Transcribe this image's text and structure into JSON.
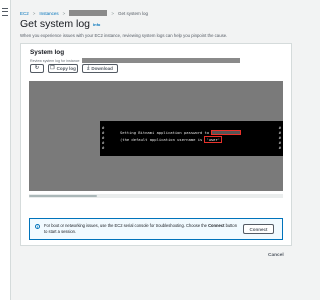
{
  "breadcrumb": {
    "items": [
      "EC2",
      "Instances",
      "",
      "Get system log"
    ],
    "separator": ">"
  },
  "page": {
    "title": "Get system log",
    "info_label": "Info",
    "description": "When you experience issues with your EC2 instance, reviewing system logs can help you pinpoint the cause."
  },
  "panel": {
    "title": "System log",
    "subtitle_prefix": "Review system log for instance",
    "refresh_icon": "refresh-icon",
    "copy_label": "Copy log",
    "copy_icon": "copy-icon",
    "download_label": "Download",
    "download_icon": "download-icon"
  },
  "console": {
    "line1": "Setting Bitnami application password to",
    "line2": "(the default application username is",
    "username": "'user'"
  },
  "alert": {
    "message_prefix": "For boot or networking issues, use the EC2 serial console for troubleshooting. Choose the",
    "message_bold": "Connect",
    "message_suffix": "button to start a session.",
    "connect_label": "Connect"
  },
  "footer": {
    "cancel_label": "Cancel"
  },
  "colors": {
    "link": "#0073bb",
    "highlight_box": "#e8312a",
    "console_bg": "#000000",
    "redaction": "#8a8a8a"
  }
}
